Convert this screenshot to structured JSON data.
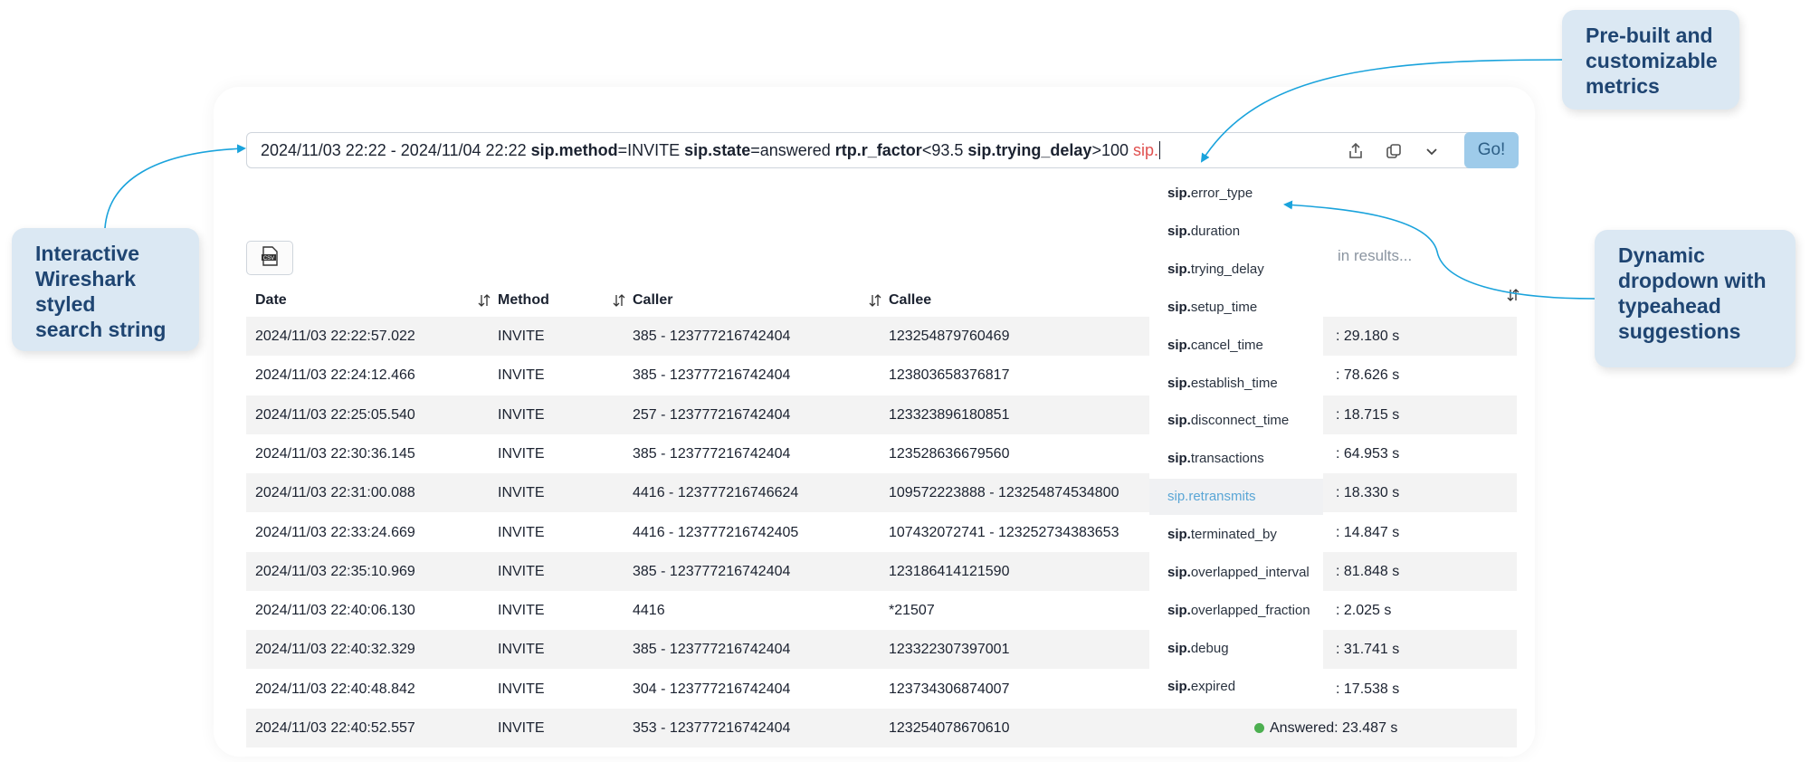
{
  "search": {
    "date_range": "2024/11/03 22:22 - 2024/11/04 22:22",
    "tokens": [
      {
        "key": "sip.method",
        "op": "=",
        "val": "INVITE"
      },
      {
        "key": "sip.state",
        "op": "=",
        "val": "answered"
      },
      {
        "key": "rtp.r_factor",
        "op": "<",
        "val": "93.5"
      },
      {
        "key": "sip.trying_delay",
        "op": ">",
        "val": "100"
      }
    ],
    "partial": "sip.",
    "icons": [
      "share-icon",
      "copy-icon",
      "chevron-down-icon"
    ],
    "go_label": "Go!"
  },
  "export_icon": "csv-export-icon",
  "hint_text": "in results...",
  "table": {
    "headers": {
      "date": "Date",
      "method": "Method",
      "caller": "Caller",
      "callee": "Callee"
    },
    "rows": [
      {
        "date": "2024/11/03 22:22:57.022",
        "method": "INVITE",
        "caller": "385 - 123777216742404",
        "callee": "123254879760469",
        "status": ": 29.180 s"
      },
      {
        "date": "2024/11/03 22:24:12.466",
        "method": "INVITE",
        "caller": "385 - 123777216742404",
        "callee": "123803658376817",
        "status": ": 78.626 s"
      },
      {
        "date": "2024/11/03 22:25:05.540",
        "method": "INVITE",
        "caller": "257 - 123777216742404",
        "callee": "123323896180851",
        "status": ": 18.715 s"
      },
      {
        "date": "2024/11/03 22:30:36.145",
        "method": "INVITE",
        "caller": "385 - 123777216742404",
        "callee": "123528636679560",
        "status": ": 64.953 s"
      },
      {
        "date": "2024/11/03 22:31:00.088",
        "method": "INVITE",
        "caller": "4416 - 123777216746624",
        "callee": "109572223888 - 123254874534800",
        "status": ": 18.330 s"
      },
      {
        "date": "2024/11/03 22:33:24.669",
        "method": "INVITE",
        "caller": "4416 - 123777216742405",
        "callee": "107432072741 - 123252734383653",
        "status": ": 14.847 s"
      },
      {
        "date": "2024/11/03 22:35:10.969",
        "method": "INVITE",
        "caller": "385 - 123777216742404",
        "callee": "123186414121590",
        "status": ": 81.848 s"
      },
      {
        "date": "2024/11/03 22:40:06.130",
        "method": "INVITE",
        "caller": "4416",
        "callee": "*21507",
        "status": ": 2.025 s"
      },
      {
        "date": "2024/11/03 22:40:32.329",
        "method": "INVITE",
        "caller": "385 - 123777216742404",
        "callee": "123322307397001",
        "status": ": 31.741 s"
      },
      {
        "date": "2024/11/03 22:40:48.842",
        "method": "INVITE",
        "caller": "304 - 123777216742404",
        "callee": "123734306874007",
        "status": ": 17.538 s"
      },
      {
        "date": "2024/11/03 22:40:52.557",
        "method": "INVITE",
        "caller": "353 - 123777216742404",
        "callee": "123254078670610",
        "status": "Answered: 23.487 s",
        "status_color": "#4caf50"
      }
    ]
  },
  "dropdown": {
    "prefix": "sip.",
    "items": [
      "error_type",
      "duration",
      "trying_delay",
      "setup_time",
      "cancel_time",
      "establish_time",
      "disconnect_time",
      "transactions",
      "retransmits",
      "terminated_by",
      "overlapped_interval",
      "overlapped_fraction",
      "debug",
      "expired"
    ],
    "highlighted": "retransmits"
  },
  "callouts": {
    "metrics": [
      "Pre-built and",
      "customizable",
      "metrics"
    ],
    "search": [
      "Interactive",
      "Wireshark",
      "styled",
      "search string"
    ],
    "dropdown": [
      "Dynamic",
      "dropdown with",
      "typeahead",
      "suggestions"
    ]
  },
  "colors": {
    "accent": "#1aa3dc",
    "callout_bg": "#dbe8f3",
    "callout_text": "#1f4572",
    "go_bg": "#9ecbea",
    "partial_token": "#e0504f"
  }
}
